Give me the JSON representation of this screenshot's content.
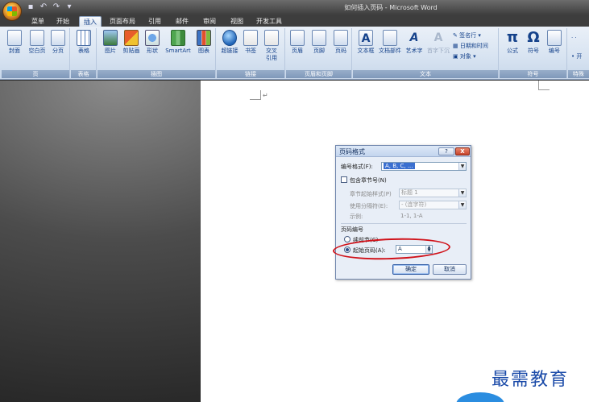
{
  "window": {
    "title": "如何插入页码 - Microsoft Word",
    "qat": [
      "save-icon",
      "undo-icon",
      "redo-icon"
    ]
  },
  "tabs": [
    {
      "label": "菜单",
      "active": false
    },
    {
      "label": "开始",
      "active": false
    },
    {
      "label": "插入",
      "active": true
    },
    {
      "label": "页面布局",
      "active": false
    },
    {
      "label": "引用",
      "active": false
    },
    {
      "label": "邮件",
      "active": false
    },
    {
      "label": "审阅",
      "active": false
    },
    {
      "label": "视图",
      "active": false
    },
    {
      "label": "开发工具",
      "active": false
    }
  ],
  "ribbon": {
    "groups": {
      "pages": "页",
      "tables": "表格",
      "illustrations": "插图",
      "links": "链接",
      "header_footer": "页眉和页脚",
      "text": "文本",
      "symbols": "符号",
      "special": "特殊"
    },
    "buttons": {
      "cover": "封面",
      "blank_page": "空白页",
      "page_break": "分页",
      "table": "表格",
      "picture": "图片",
      "clip_art": "剪贴画",
      "shapes": "形状",
      "smartart": "SmartArt",
      "chart": "图表",
      "hyperlink": "超链接",
      "bookmark": "书签",
      "cross_ref_1": "交叉",
      "cross_ref_2": "引用",
      "header": "页眉",
      "footer": "页脚",
      "page_number": "页码",
      "textbox": "文本框",
      "quick_parts": "文档部件",
      "wordart": "艺术字",
      "dropcap": "首字下沉",
      "equation": "公式",
      "symbol": "符号",
      "number": "编号"
    },
    "small": {
      "signature": "签名行",
      "datetime": "日期和时间",
      "object": "对象"
    }
  },
  "document": {
    "para_mark": "↵"
  },
  "dialog": {
    "title": "页码格式",
    "help": "?",
    "close": "X",
    "number_format_label": "编号格式(F):",
    "number_format_value": "A, B, C, ...",
    "include_chapter_label": "包含章节号(N)",
    "chapter_style_label": "章节起始样式(P)",
    "chapter_style_value": "标题 1",
    "separator_label": "使用分隔符(E):",
    "separator_value": "-  (连字符)",
    "example_label": "示例:",
    "example_value": "1-1, 1-A",
    "page_numbering_label": "页码编号",
    "continue_label": "续前节(C)",
    "start_at_label": "起始页码(A):",
    "start_at_value": "A",
    "ok": "确定",
    "cancel": "取消"
  },
  "watermark": "最需教育",
  "colors": {
    "annotation": "#d0121a",
    "ribbon_text": "#15428b"
  }
}
